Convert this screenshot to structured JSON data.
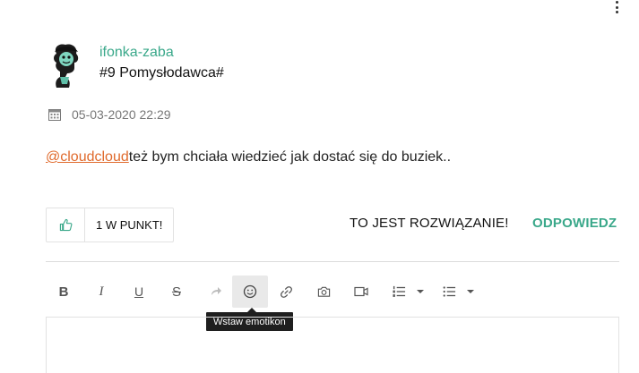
{
  "post": {
    "username": "ifonka-zaba",
    "rank": "#9 Pomysłodawca#",
    "date": "05-03-2020 22:29",
    "mention": "@cloudcloud",
    "message": "też bym chciała wiedzieć jak dostać się do buziek.."
  },
  "actions": {
    "points_label": "1 W PUNKT!",
    "solution_label": "TO JEST ROZWIĄZANIE!",
    "reply_label": "ODPOWIEDZ"
  },
  "toolbar": {
    "bold": "B",
    "italic": "I",
    "underline": "U",
    "strike": "S",
    "tooltip": "Wstaw emotikon"
  },
  "colors": {
    "accent_green": "#3aa88a",
    "mention_orange": "#e06a2c"
  },
  "icons": [
    "more-vertical-icon",
    "calendar-icon",
    "thumbs-up-icon",
    "redo-icon",
    "emoji-icon",
    "link-icon",
    "camera-icon",
    "video-icon",
    "ordered-list-icon",
    "bullet-list-icon"
  ]
}
